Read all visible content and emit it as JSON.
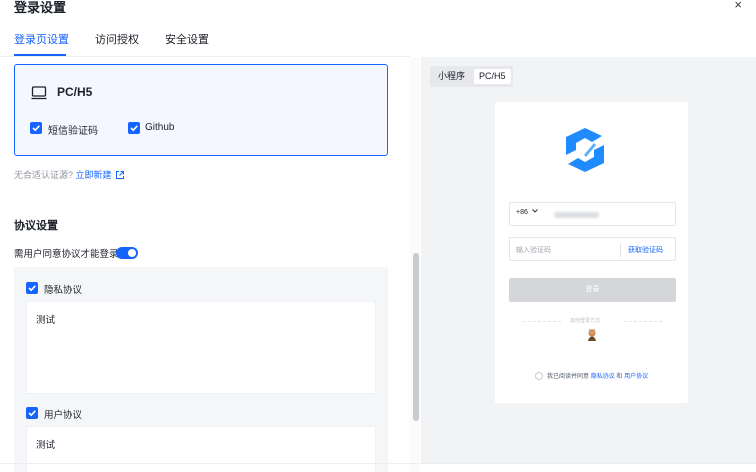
{
  "dialog": {
    "title": "登录设置",
    "close_glyph": "×"
  },
  "tabs": [
    {
      "label": "登录页设置",
      "active": true
    },
    {
      "label": "访问授权",
      "active": false
    },
    {
      "label": "安全设置",
      "active": false
    }
  ],
  "platform_card": {
    "icon": "desktop-icon",
    "title": "PC/H5",
    "options": [
      {
        "label": "短信验证码",
        "checked": true
      },
      {
        "label": "Github",
        "checked": true
      }
    ]
  },
  "hint": {
    "text": "无合适认证源?",
    "link": "立即新建",
    "link_icon": "external-link-icon"
  },
  "agreement_section": {
    "title": "协议设置",
    "consent_label": "需用户同意协议才能登录",
    "consent_enabled": true,
    "agreements": [
      {
        "label": "隐私协议",
        "checked": true,
        "content": "测试"
      },
      {
        "label": "用户协议",
        "checked": true,
        "content": "测试"
      }
    ]
  },
  "preview": {
    "segments": [
      {
        "label": "小程序",
        "active": false
      },
      {
        "label": "PC/H5",
        "active": true
      }
    ],
    "phone_prefix": "+86",
    "code_placeholder": "输入验证码",
    "get_code_label": "获取验证码",
    "login_label": "登录",
    "other_methods": "其他登录方式",
    "agree_text": "我已阅读并同意",
    "privacy_link": "隐私协议",
    "and_text": "和",
    "user_link": "用户协议"
  },
  "colors": {
    "accent": "#1664ff",
    "card_bg": "#f4f7ff",
    "panel_bg": "#f2f3f5"
  }
}
